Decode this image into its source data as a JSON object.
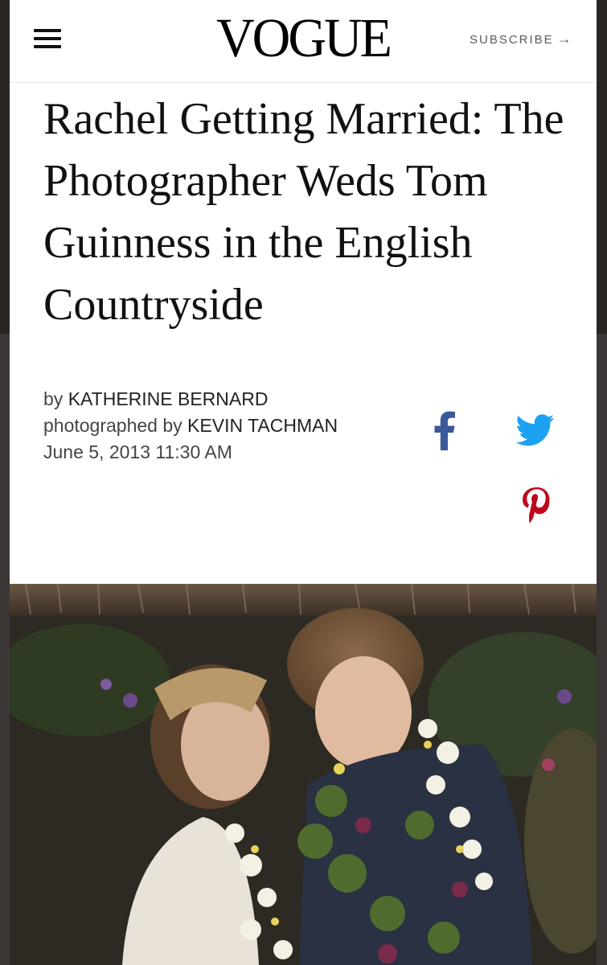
{
  "header": {
    "logo": "VOGUE",
    "subscribe_label": "SUBSCRIBE",
    "subscribe_arrow": "→"
  },
  "article": {
    "headline": "Rachel Getting Married: The Photographer Weds Tom Guinness in the English Countryside",
    "by_label": "by",
    "author": "KATHERINE BERNARD",
    "photo_label": "photographed by",
    "photographer": "KEVIN TACHMAN",
    "date": "June 5, 2013 11:30 AM"
  },
  "share": {
    "facebook_icon": "facebook-icon",
    "twitter_icon": "twitter-icon",
    "pinterest_icon": "pinterest-icon"
  },
  "colors": {
    "facebook": "#3b5998",
    "twitter": "#1da1f2",
    "pinterest": "#bd081c"
  }
}
